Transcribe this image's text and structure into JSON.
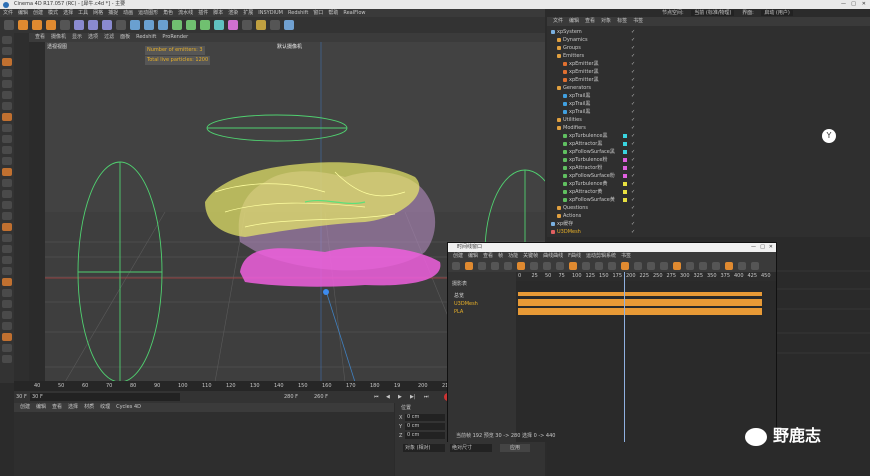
{
  "window": {
    "title": "Cinema 4D R17.057 (RC) - [犀牛.c4d *] - 主要"
  },
  "menu": [
    "文件",
    "编辑",
    "创建",
    "模式",
    "选择",
    "工具",
    "网格",
    "捕捉",
    "动画",
    "运动图形",
    "角色",
    "流水线",
    "插件",
    "脚本",
    "渲染",
    "扩展",
    "INSYDIUM",
    "Redshift",
    "窗口",
    "帮助",
    "RealFlow"
  ],
  "top_right": {
    "node_label": "节点空间:",
    "node_value": "当前 (标准/物理)",
    "layout_label": "界面:",
    "layout_value": "启动 (用户)"
  },
  "viewport": {
    "menu": [
      "查看",
      "摄像机",
      "显示",
      "选项",
      "过滤",
      "面板",
      "Redshift",
      "ProRender"
    ],
    "name": "透视视图",
    "camera": "默认摄像机",
    "hud": {
      "emitters": "Number of emitters: 3",
      "particles": "Total live particles: 1200"
    }
  },
  "timeline_ruler": [
    "40",
    "50",
    "60",
    "70",
    "80",
    "90",
    "100",
    "110",
    "120",
    "130",
    "140",
    "150",
    "160",
    "170",
    "180",
    "19",
    "200",
    "210",
    "220",
    "230",
    "240",
    "250"
  ],
  "transport": {
    "start": "30 F",
    "cur": "30 F",
    "end": "280 F",
    "end2": "260 F"
  },
  "material_tabs": [
    "创建",
    "编辑",
    "查看",
    "选择",
    "材质",
    "纹理",
    "Cycles 4D"
  ],
  "coords": {
    "title": "位置",
    "x": "X",
    "y": "Y",
    "z": "Z",
    "xv": "0 cm",
    "yv": "0 cm",
    "zv": "0 cm",
    "mode": "对象 (相对)",
    "size_mode": "绝对尺寸",
    "apply": "应用"
  },
  "object_manager": {
    "tabs": [
      "文件",
      "编辑",
      "查看",
      "对象",
      "标签",
      "书签"
    ],
    "rows": [
      {
        "name": "xpSystem",
        "depth": 0,
        "icon": "#7ab0e0",
        "swatch": ""
      },
      {
        "name": "Dynamics",
        "depth": 1,
        "icon": "#e0a040",
        "swatch": ""
      },
      {
        "name": "Groups",
        "depth": 1,
        "icon": "#e0a040",
        "swatch": ""
      },
      {
        "name": "Emitters",
        "depth": 1,
        "icon": "#e0a040",
        "swatch": ""
      },
      {
        "name": "xpEmitter黑",
        "depth": 2,
        "icon": "#e07030",
        "swatch": ""
      },
      {
        "name": "xpEmitter黑",
        "depth": 2,
        "icon": "#e07030",
        "swatch": ""
      },
      {
        "name": "xpEmitter黑",
        "depth": 2,
        "icon": "#e07030",
        "swatch": ""
      },
      {
        "name": "Generators",
        "depth": 1,
        "icon": "#e0a040",
        "swatch": ""
      },
      {
        "name": "xpTrail黑",
        "depth": 2,
        "icon": "#40a0e0",
        "swatch": ""
      },
      {
        "name": "xpTrail黑",
        "depth": 2,
        "icon": "#40a0e0",
        "swatch": ""
      },
      {
        "name": "xpTrail黑",
        "depth": 2,
        "icon": "#40a0e0",
        "swatch": ""
      },
      {
        "name": "Utilities",
        "depth": 1,
        "icon": "#e0a040",
        "swatch": ""
      },
      {
        "name": "Modifiers",
        "depth": 1,
        "icon": "#e0a040",
        "swatch": ""
      },
      {
        "name": "xpTurbulence黑",
        "depth": 2,
        "icon": "#60c060",
        "swatch": "#39d5e0"
      },
      {
        "name": "xpAttractor黑",
        "depth": 2,
        "icon": "#60c060",
        "swatch": "#39d5e0"
      },
      {
        "name": "xpFollowSurface黑",
        "depth": 2,
        "icon": "#60c060",
        "swatch": "#39d5e0"
      },
      {
        "name": "xpTurbulence粉",
        "depth": 2,
        "icon": "#60c060",
        "swatch": "#e060e0"
      },
      {
        "name": "xpAttractor粉",
        "depth": 2,
        "icon": "#60c060",
        "swatch": "#e060e0"
      },
      {
        "name": "xpFollowSurface粉",
        "depth": 2,
        "icon": "#60c060",
        "swatch": "#e060e0"
      },
      {
        "name": "xpTurbulence黄",
        "depth": 2,
        "icon": "#60c060",
        "swatch": "#e8e040"
      },
      {
        "name": "xpAttractor黄",
        "depth": 2,
        "icon": "#60c060",
        "swatch": "#e8e040"
      },
      {
        "name": "xpFollowSurface黄",
        "depth": 2,
        "icon": "#60c060",
        "swatch": "#e8e040"
      },
      {
        "name": "Questions",
        "depth": 1,
        "icon": "#e0a040",
        "swatch": ""
      },
      {
        "name": "Actions",
        "depth": 1,
        "icon": "#e0a040",
        "swatch": ""
      },
      {
        "name": "xp缓存",
        "depth": 0,
        "icon": "#7ab0e0",
        "swatch": ""
      },
      {
        "name": "U3DMesh",
        "depth": 0,
        "icon": "#e06060",
        "swatch": ""
      }
    ]
  },
  "timeline_window": {
    "title": "时间线窗口",
    "menu": [
      "创建",
      "编辑",
      "查看",
      "帧",
      "功能",
      "关键帧",
      "曲线曲线",
      "F曲线",
      "运动剪辑系统",
      "书签"
    ],
    "left_label": "摄影表",
    "tracks": [
      {
        "name": "总览"
      },
      {
        "name": "U3DMesh"
      },
      {
        "name": "PLA"
      }
    ],
    "ruler": [
      "0",
      "25",
      "50",
      "75",
      "100",
      "125",
      "150",
      "175",
      "200",
      "225",
      "250",
      "275",
      "300",
      "325",
      "350",
      "375",
      "400",
      "425",
      "450"
    ],
    "status": "当前帧 192 预览 30 -> 280 选择 0 -> 440"
  },
  "watermark": "野鹿志",
  "colors": {
    "accent": "#e8b028",
    "yellow": "#f0f060",
    "pink": "#f060e0",
    "green": "#50d070"
  }
}
